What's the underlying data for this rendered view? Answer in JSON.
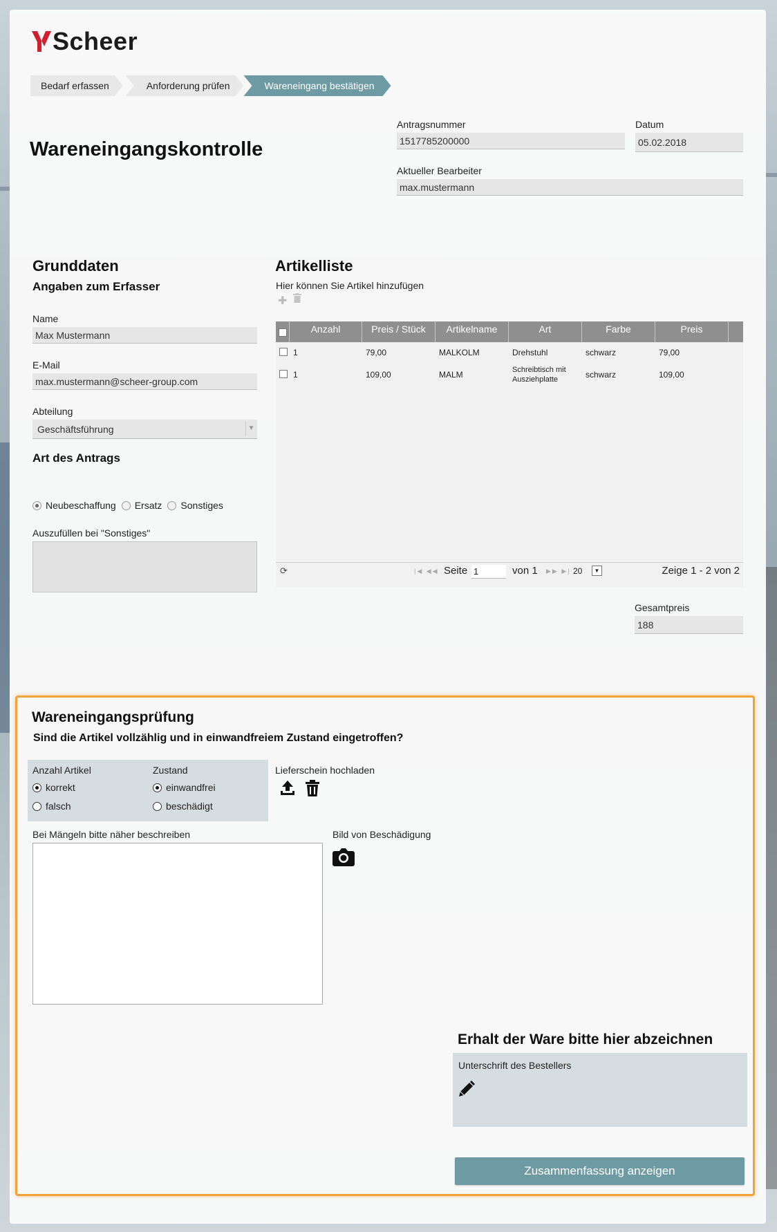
{
  "logo": {
    "text": "Scheer"
  },
  "breadcrumb": {
    "steps": [
      "Bedarf erfassen",
      "Anforderung prüfen",
      "Wareneingang bestätigen"
    ]
  },
  "page_title": "Wareneingangskontrolle",
  "header_fields": {
    "antragsnummer_label": "Antragsnummer",
    "antragsnummer_value": "1517785200000",
    "datum_label": "Datum",
    "datum_value": "05.02.2018",
    "bearbeiter_label": "Aktueller Bearbeiter",
    "bearbeiter_value": "max.mustermann"
  },
  "grunddaten": {
    "title": "Grunddaten",
    "subtitle": "Angaben zum Erfasser",
    "name_label": "Name",
    "name_value": "Max Mustermann",
    "email_label": "E-Mail",
    "email_value": "max.mustermann@scheer-group.com",
    "abteilung_label": "Abteilung",
    "abteilung_value": "Geschäftsführung",
    "art_title": "Art des Antrags",
    "art_options": [
      "Neubeschaffung",
      "Ersatz",
      "Sonstiges"
    ],
    "art_selected": "Neubeschaffung",
    "sonstiges_label": "Auszufüllen bei \"Sonstiges\""
  },
  "artikelliste": {
    "title": "Artikelliste",
    "hint": "Hier können Sie Artikel hinzufügen",
    "columns": [
      "Anzahl",
      "Preis / Stück",
      "Artikelname",
      "Art",
      "Farbe",
      "Preis"
    ],
    "rows": [
      {
        "anzahl": "1",
        "preis_stueck": "79,00",
        "artikelname": "MALKOLM",
        "art": "Drehstuhl",
        "farbe": "schwarz",
        "preis": "79,00"
      },
      {
        "anzahl": "1",
        "preis_stueck": "109,00",
        "artikelname": "MALM",
        "art_line1": "Schreibtisch mit",
        "art_line2": "Ausziehplatte",
        "farbe": "schwarz",
        "preis": "109,00"
      }
    ],
    "pager": {
      "seite_label": "Seite",
      "seite_value": "1",
      "von_label": "von 1",
      "page_size": "20",
      "summary": "Zeige 1 - 2 von 2"
    },
    "gesamtpreis_label": "Gesamtpreis",
    "gesamtpreis_value": "188"
  },
  "wareneingang": {
    "title": "Wareneingangsprüfung",
    "question": "Sind die Artikel vollzählig und in einwandfreiem Zustand eingetroffen?",
    "anzahl_label": "Anzahl Artikel",
    "anzahl_options": [
      "korrekt",
      "falsch"
    ],
    "anzahl_selected": "korrekt",
    "zustand_label": "Zustand",
    "zustand_options": [
      "einwandfrei",
      "beschädigt"
    ],
    "zustand_selected": "einwandfrei",
    "lieferschein_label": "Lieferschein hochladen",
    "maengel_label": "Bei Mängeln bitte näher beschreiben",
    "bild_label": "Bild von Beschädigung",
    "signature_title": "Erhalt der Ware bitte hier abzeichnen",
    "signature_label": "Unterschrift des Bestellers",
    "summary_button": "Zusammenfassung anzeigen"
  },
  "colors": {
    "accent": "#6e9ba3",
    "highlight_border": "#f0a33a",
    "logo_red": "#d0202e",
    "grid_header": "#8f8f8f"
  }
}
